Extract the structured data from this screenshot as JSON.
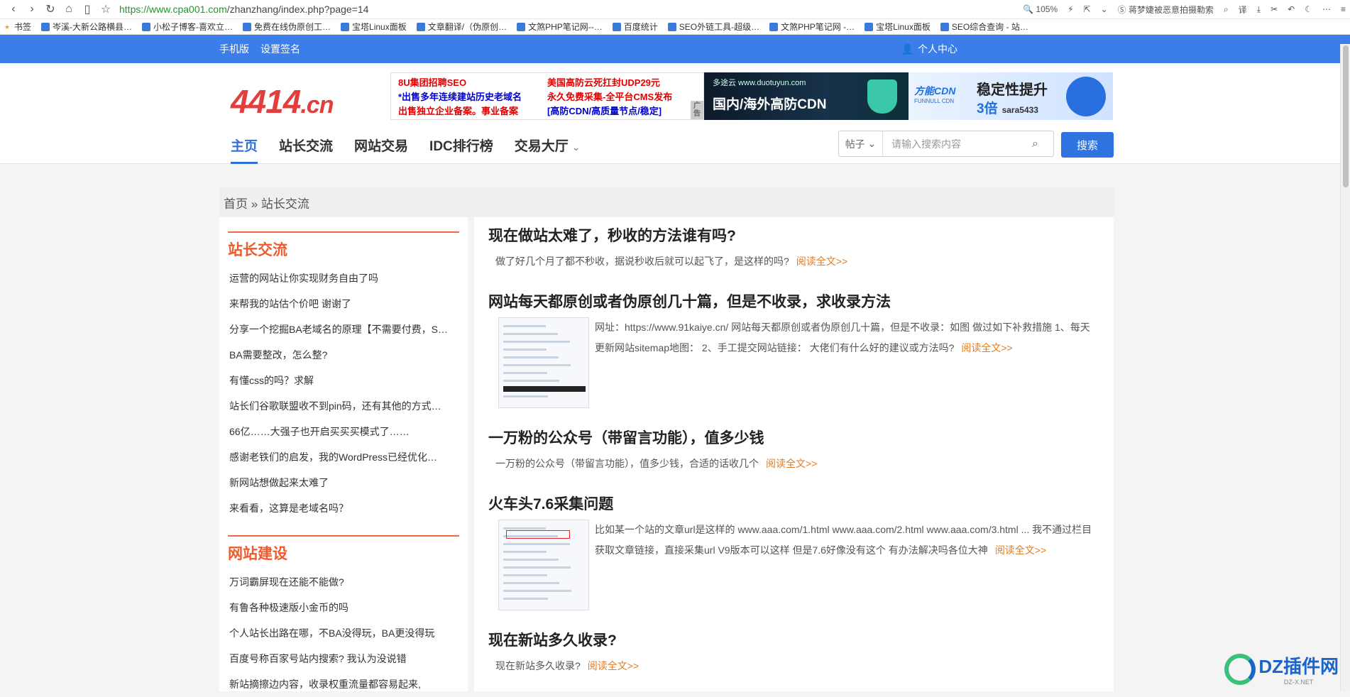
{
  "browser": {
    "url_prefix": "https://",
    "url_domain": "www.cpa001.com",
    "url_path": "/zhanzhang/index.php?page=14",
    "zoom": "105%",
    "news_text": "蒋梦婕被恶意拍摄勒索"
  },
  "bookmarks": [
    "书签",
    "岑溪-大新公路横县…",
    "小松子博客-喜欢立…",
    "免费在线伪原创工…",
    "宝塔Linux面板",
    "文章翻译/（伪原创…",
    "文煞PHP笔记网--…",
    "百度统计",
    "SEO外链工具-超级…",
    "文煞PHP笔记网 -…",
    "宝塔Linux面板",
    "SEO综合查询 - 站…"
  ],
  "topbar": {
    "mobile": "手机版",
    "set_sign": "设置签名",
    "user_center": "个人中心"
  },
  "logo": {
    "main": "4414",
    "tld": ".cn"
  },
  "ads": {
    "ad1": [
      "8U集团招聘SEO",
      "美国高防云死扛封UDP29元",
      "*出售多年连续建站历史老域名",
      "永久免费采集-全平台CMS发布",
      "出售独立企业备案。事业备案",
      "[高防CDN/高质量节点/稳定]"
    ],
    "ad1_tag": "广告",
    "ad2_site": "多途云 www.duotuyun.com",
    "ad2_title": "国内/海外高防CDN",
    "ad3_brand": "FUNNULL CDN",
    "ad3_brand_cn": "方能CDN",
    "ad3_head": "稳定性提升",
    "ad3_sub": "3倍",
    "ad3_user": "sara5433"
  },
  "nav": [
    "主页",
    "站长交流",
    "网站交易",
    "IDC排行榜",
    "交易大厅"
  ],
  "search": {
    "type": "帖子",
    "placeholder": "请输入搜索内容",
    "button": "搜索"
  },
  "breadcrumb": "首页 » 站长交流",
  "sidebar": [
    {
      "title": "站长交流",
      "items": [
        "运营的网站让你实现财务自由了吗",
        "来帮我的站估个价吧 谢谢了",
        "分享一个挖掘BA老域名的原理【不需要付费，S…",
        "BA需要整改，怎么整?",
        "有懂css的吗？求解",
        "站长们谷歌联盟收不到pin码，还有其他的方式…",
        "66亿……大强子也开启买买买模式了……",
        "感谢老铁们的启发，我的WordPress已经优化…",
        "新网站想做起来太难了",
        "来看看，这算是老域名吗？"
      ]
    },
    {
      "title": "网站建设",
      "items": [
        "万词霸屏现在还能不能做?",
        "有鲁各种极速版小金币的吗",
        "个人站长出路在哪，不BA没得玩，BA更没得玩",
        "百度号称百家号站内搜索? 我认为没说错",
        "新站摘擦边内容，收录权重流量都容易起来,"
      ]
    }
  ],
  "posts": [
    {
      "title": "现在做站太难了，秒收的方法谁有吗?",
      "excerpt": "做了好几个月了都不秒收，据说秒收后就可以起飞了，是这样的吗?",
      "more": "阅读全文>>"
    },
    {
      "title": "网站每天都原创或者伪原创几十篇，但是不收录，求收录方法",
      "excerpt": "网址：https://www.91kaiye.cn/ 网站每天都原创或者伪原创几十篇，但是不收录：如图 做过如下补救措施 1、每天更新网站sitemap地图： 2、手工提交网站链接： 大佬们有什么好的建议或方法吗?",
      "more": "阅读全文>>"
    },
    {
      "title": "一万粉的公众号（带留言功能），值多少钱",
      "excerpt": "一万粉的公众号（带留言功能），值多少钱，合适的话收几个",
      "more": "阅读全文>>"
    },
    {
      "title": "火车头7.6采集问题",
      "excerpt": "比如某一个站的文章url是这样的 www.aaa.com/1.html www.aaa.com/2.html www.aaa.com/3.html ... 我不通过栏目获取文章链接，直接采集url V9版本可以这样 但是7.6好像没有这个 有办法解决吗各位大神",
      "more": "阅读全文>>"
    },
    {
      "title": "现在新站多久收录?",
      "excerpt": "现在新站多久收录?",
      "more": "阅读全文>>"
    }
  ],
  "watermark": {
    "text": "DZ插件网",
    "sub": "DZ-X.NET"
  }
}
